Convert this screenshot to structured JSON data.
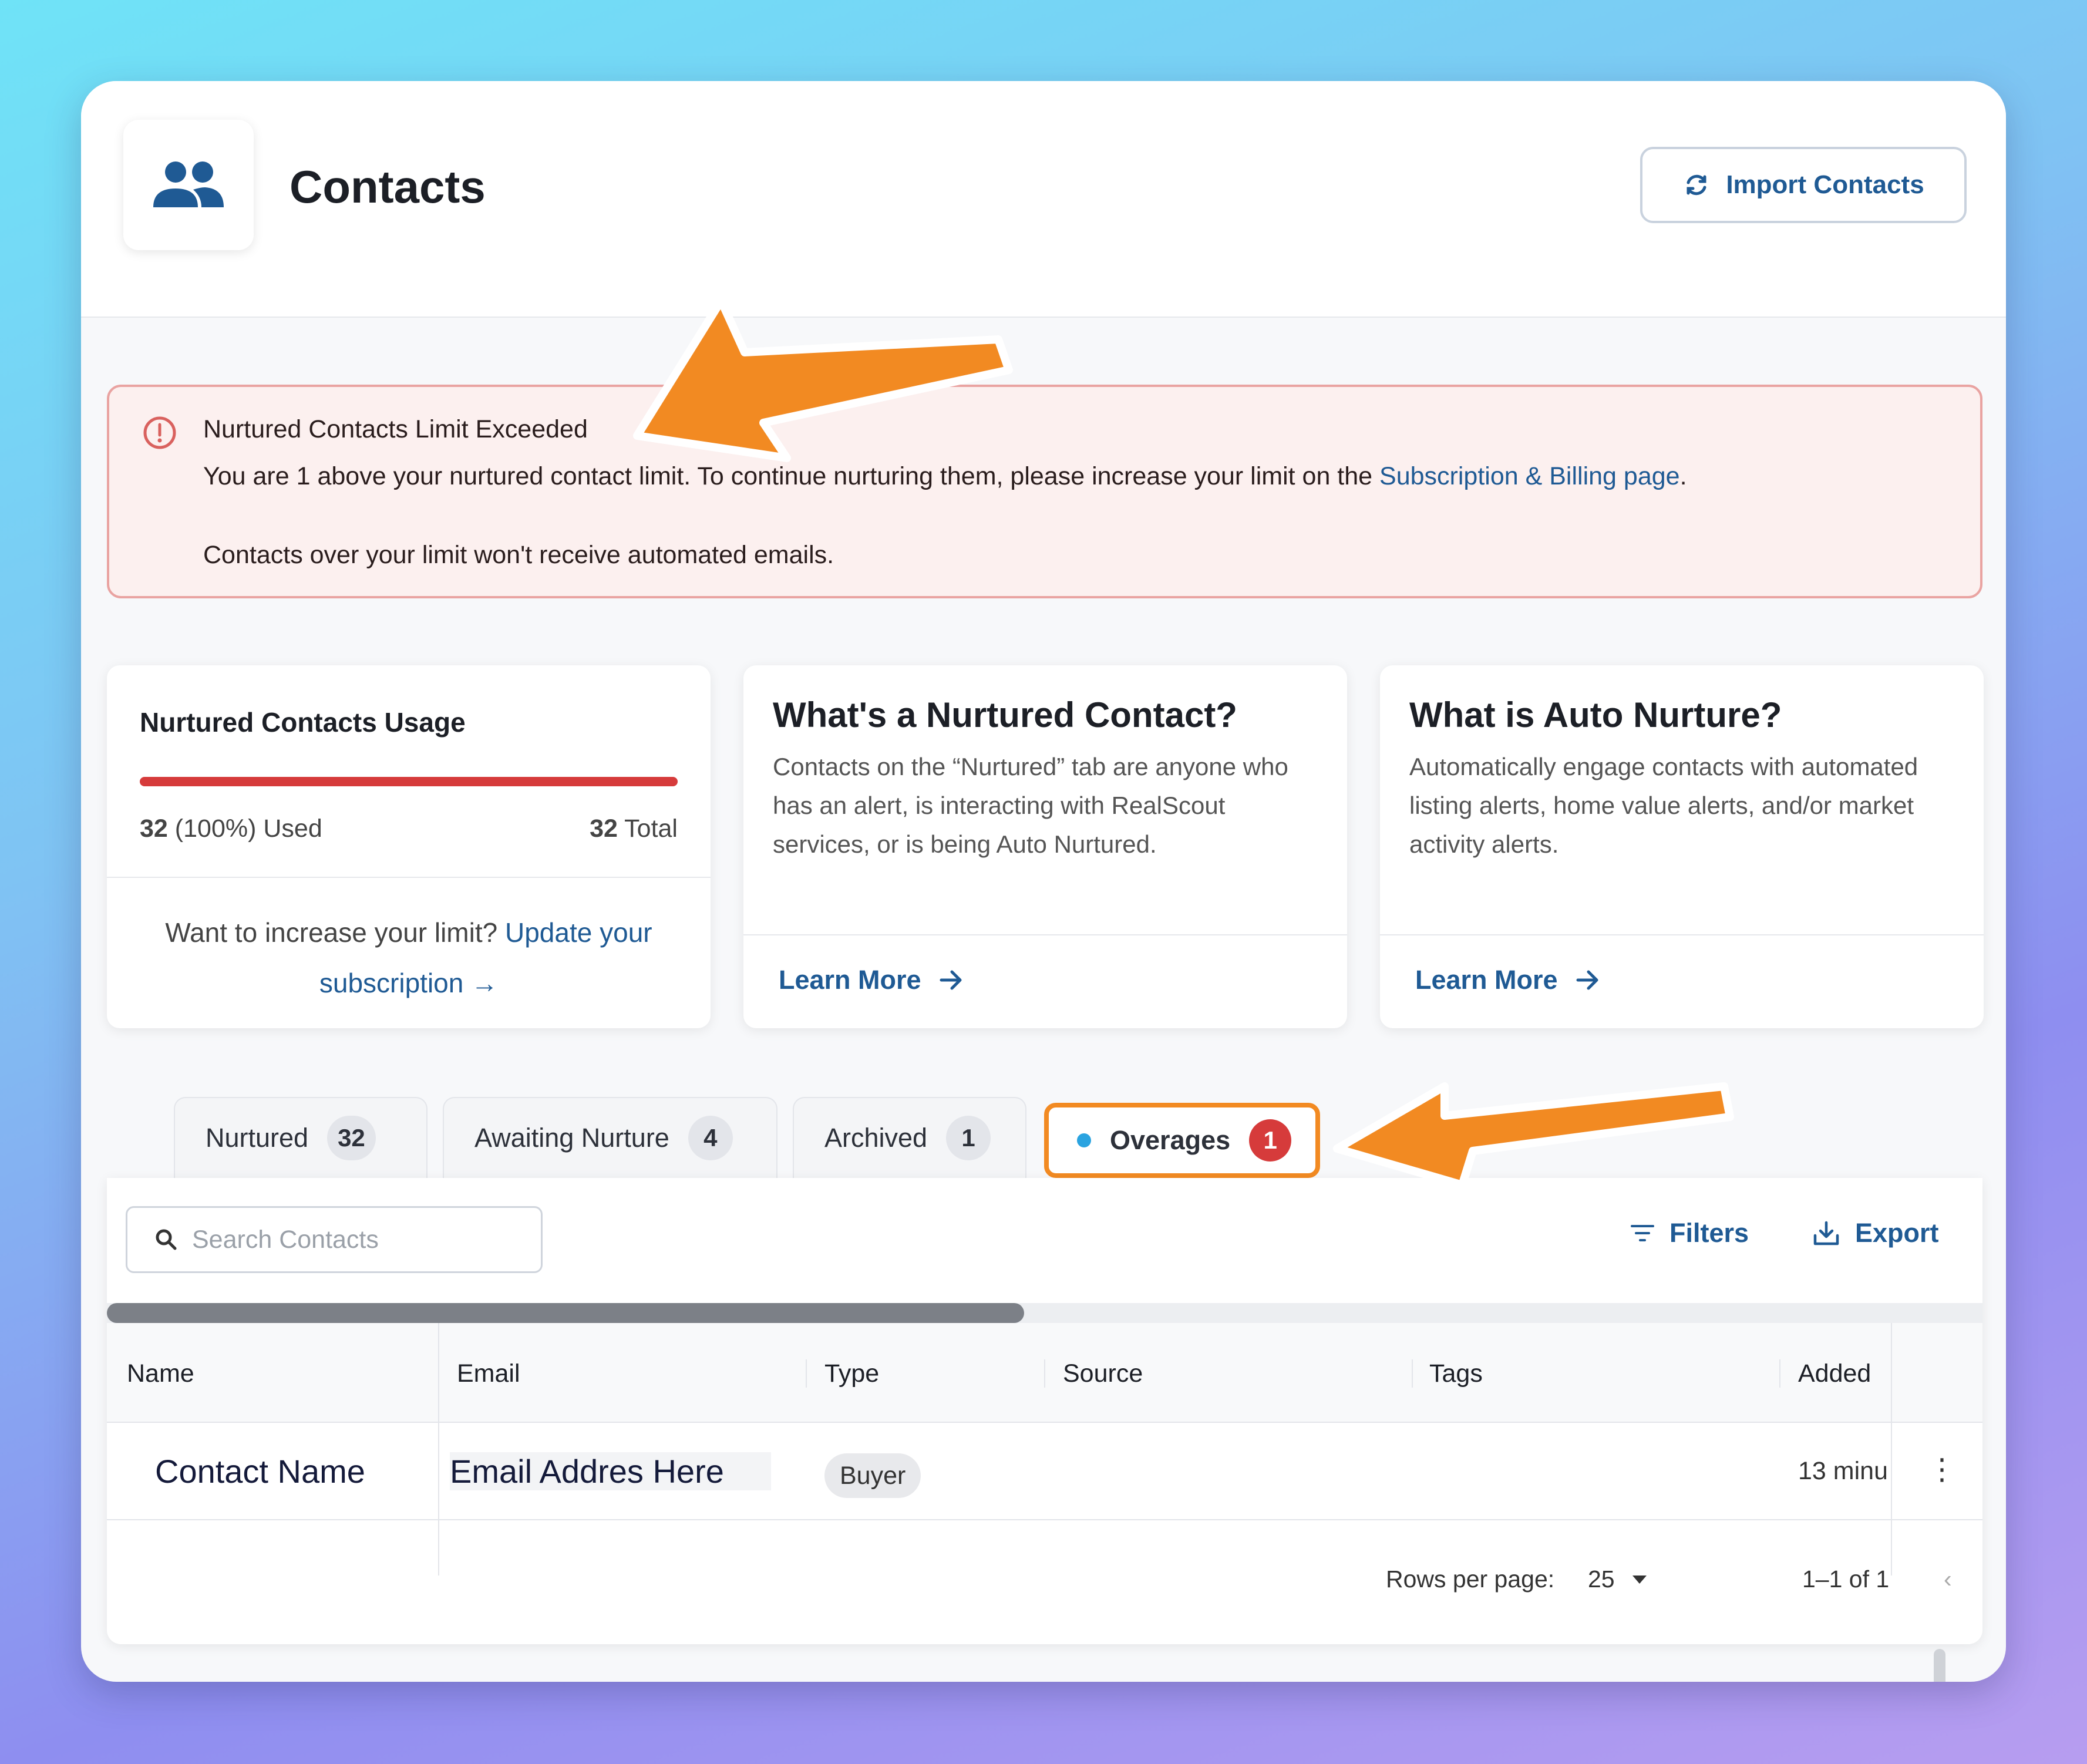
{
  "header": {
    "title": "Contacts",
    "import_button": "Import Contacts"
  },
  "alert": {
    "title": "Nurtured Contacts Limit Exceeded",
    "message_before_link": "You are 1 above your nurtured contact limit. To continue nurturing them, please increase your limit on the ",
    "link": "Subscription & Billing page",
    "message_after_link": ".",
    "note": "Contacts over your limit won't receive automated emails."
  },
  "usage_card": {
    "title": "Nurtured Contacts Usage",
    "used_value": "32",
    "used_text": "(100%) Used",
    "total_value": "32",
    "total_text": "Total",
    "usage_fraction": 1.0,
    "footer_text": "Want to increase your limit?",
    "footer_link_1": "Update your",
    "footer_link_2": "subscription →"
  },
  "info_cards": [
    {
      "title": "What's a Nurtured Contact?",
      "body": "Contacts on the “Nurtured” tab are anyone who has an alert, is interacting with RealScout services, or is being Auto Nurtured.",
      "link": "Learn More"
    },
    {
      "title": "What is Auto Nurture?",
      "body": "Automatically engage contacts with automated listing alerts, home value alerts, and/or market activity alerts.",
      "link": "Learn More"
    }
  ],
  "tabs": [
    {
      "label": "Nurtured",
      "count": "32"
    },
    {
      "label": "Awaiting Nurture",
      "count": "4"
    },
    {
      "label": "Archived",
      "count": "1"
    },
    {
      "label": "Overages",
      "count": "1"
    }
  ],
  "toolbar": {
    "search_placeholder": "Search Contacts",
    "filters": "Filters",
    "export": "Export"
  },
  "table": {
    "columns": [
      "Name",
      "Email",
      "Type",
      "Source",
      "Tags",
      "Added"
    ],
    "rows": [
      {
        "name": "Contact Name",
        "email": "Email Addres Here",
        "type": "Buyer",
        "added": "13 minu"
      }
    ]
  },
  "pagination": {
    "rows_per_page_label": "Rows per page:",
    "rows_per_page": "25",
    "range": "1–1 of 1"
  },
  "colors": {
    "brand_blue": "#1f5a94",
    "alert_red": "#d63b3b",
    "highlight_orange": "#f28a22",
    "status_dot": "#2aa3e0"
  }
}
